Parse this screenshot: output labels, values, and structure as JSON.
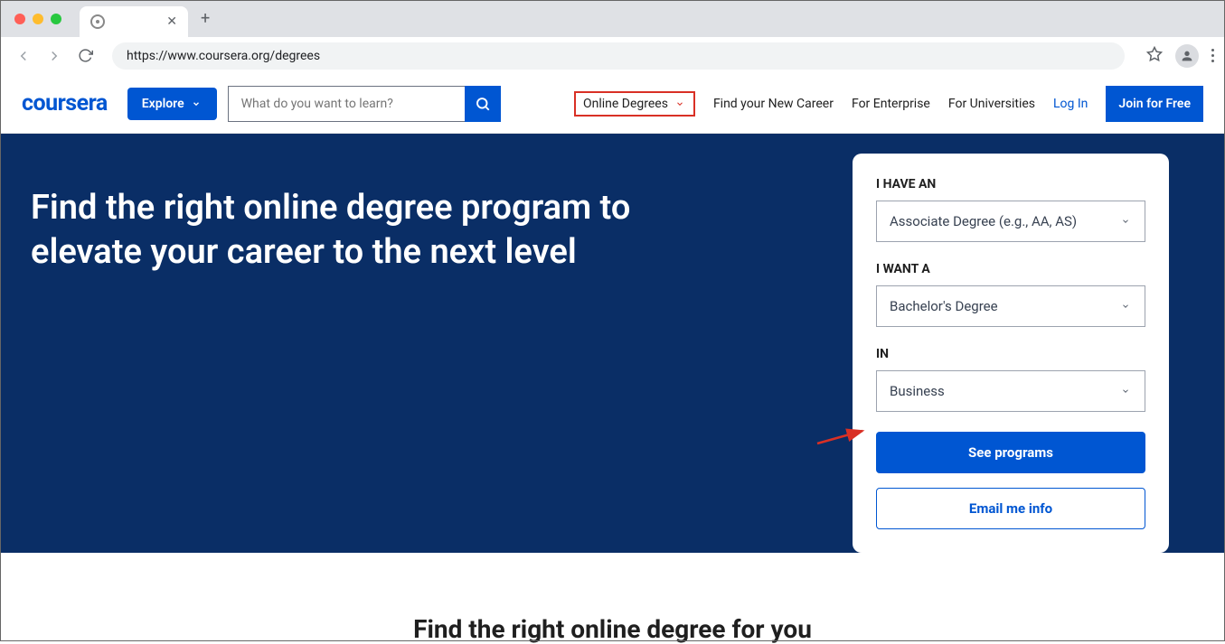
{
  "browser": {
    "url": "https://www.coursera.org/degrees"
  },
  "header": {
    "logo": "coursera",
    "explore": "Explore",
    "search_placeholder": "What do you want to learn?",
    "nav": {
      "online_degrees": "Online Degrees",
      "find_career": "Find your New Career",
      "for_enterprise": "For Enterprise",
      "for_universities": "For Universities",
      "log_in": "Log In",
      "join_free": "Join for Free"
    }
  },
  "hero": {
    "title": "Find the right online degree program to elevate your career to the next level"
  },
  "form": {
    "label1": "I HAVE AN",
    "select1": "Associate Degree (e.g., AA, AS)",
    "label2": "I WANT A",
    "select2": "Bachelor's Degree",
    "label3": "IN",
    "select3": "Business",
    "see_programs": "See programs",
    "email_info": "Email me info"
  },
  "below": {
    "title": "Find the right online degree for you"
  }
}
